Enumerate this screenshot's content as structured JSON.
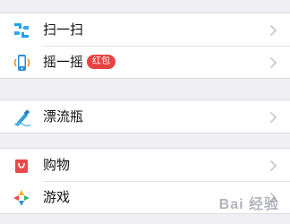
{
  "groups": [
    {
      "items": [
        {
          "label": "扫一扫",
          "icon": "scan-icon"
        },
        {
          "label": "摇一摇",
          "icon": "shake-icon",
          "badge": "红包"
        }
      ]
    },
    {
      "items": [
        {
          "label": "漂流瓶",
          "icon": "drift-bottle-icon"
        }
      ]
    },
    {
      "items": [
        {
          "label": "购物",
          "icon": "shopping-icon"
        },
        {
          "label": "游戏",
          "icon": "games-icon"
        }
      ]
    }
  ],
  "watermark": "Bai 经验",
  "colors": {
    "background": "#efeff4",
    "badge": "#e64340",
    "scan": "#1aa3e8",
    "shopping": "#e64b4b"
  }
}
